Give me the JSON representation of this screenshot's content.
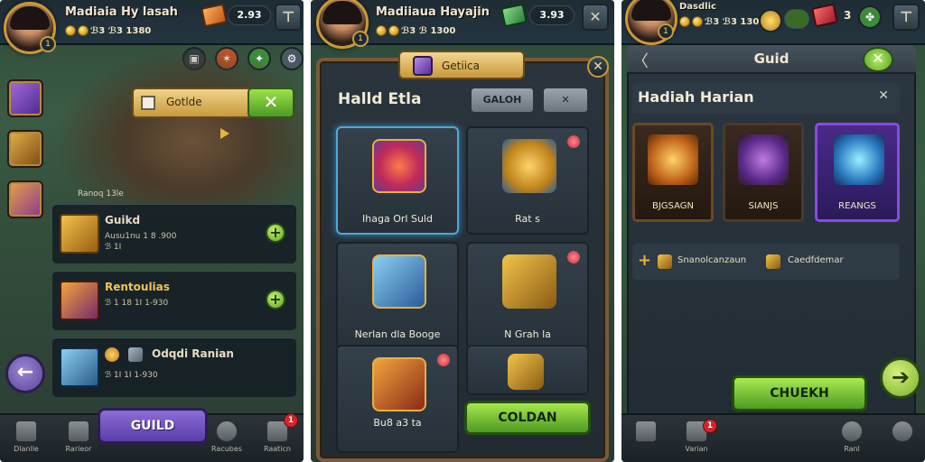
{
  "panel1": {
    "player_name": "Madiaia Hy lasah",
    "gold": "2.93",
    "stat_line": "ℬ3 ℬ3 1380",
    "guild_bar_label": "Gotlde",
    "close_symbol": "✕",
    "section_label": "Ranoq 13le",
    "rows": [
      {
        "title": "Guikd",
        "sub": "Ausu1nu 1 8 .900",
        "sub2": "ℬ 1I"
      },
      {
        "title": "Rentoulias",
        "sub": "ℬ 1 18 1I 1-930",
        "sub2": ""
      },
      {
        "title": "Odqdi Ranian",
        "sub": "ℬ 1I 1I 1-930",
        "sub2": ""
      }
    ],
    "back_symbol": "←",
    "guild_button": "GUILD",
    "nav": [
      {
        "label": "Dlanlle"
      },
      {
        "label": "Rarieor"
      },
      {
        "label": "Racubes"
      },
      {
        "label": "Raaticn"
      }
    ],
    "nav_badge": "1",
    "colors": {
      "accent": "#c89a3a",
      "guild_button": "#6b4fc0",
      "green": "#6bb82e"
    }
  },
  "panel2": {
    "player_name": "Madiiaua Hayajin",
    "gold": "3.93",
    "stat_line": "ℬ3 ℬ 1300",
    "ribbon_title": "Getiica",
    "close_symbol": "✕",
    "heading": "Halld Etla",
    "tab_label": "GALOH",
    "tab_x": "✕",
    "cards": [
      {
        "label": "Ihaga Orl Suld"
      },
      {
        "label": "Rat s"
      },
      {
        "label": "Nerlan dla Booge"
      },
      {
        "label": "N Grah la"
      },
      {
        "label": "Bu8 a3 ta"
      }
    ],
    "collect_button": "COLDAN"
  },
  "panel3": {
    "player_name": "Dasdlic",
    "stat_line": "ℬ3 ℬ3 1300",
    "gold_small": "3",
    "header_title": "Guid",
    "back_symbol": "〈",
    "subheading": "Hadiah Harian",
    "close_symbol": "✕",
    "rewards": [
      {
        "label": "BJGSAGN"
      },
      {
        "label": "SIANJS"
      },
      {
        "label": "REANGS"
      }
    ],
    "info_text_1": "Snanolcanzaun",
    "info_text_2": "Caedfdemar",
    "check_button": "CHUEKH",
    "arrow_symbol": "➔",
    "nav": [
      {
        "label": ""
      },
      {
        "label": "Varian"
      },
      {
        "label": "Ranl"
      },
      {
        "label": ""
      }
    ],
    "nav_badge": "1"
  }
}
